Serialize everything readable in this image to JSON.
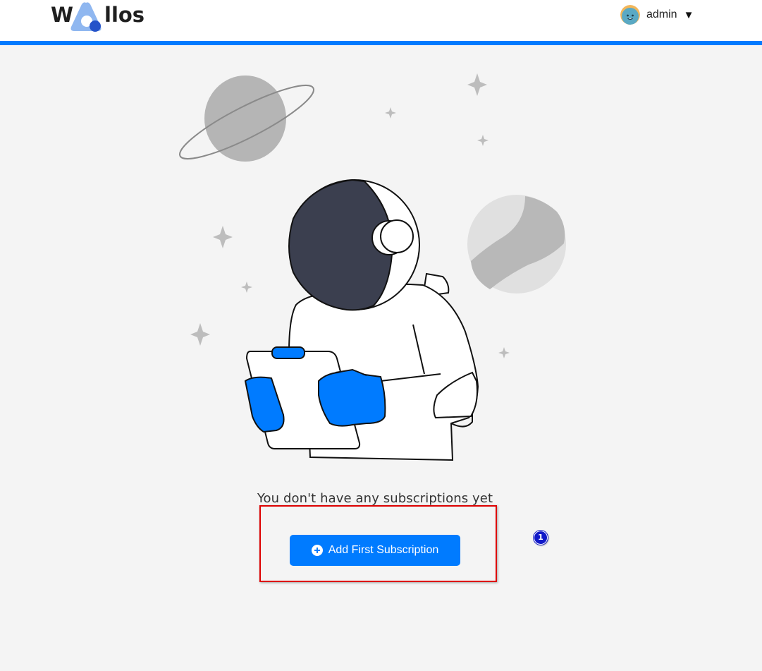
{
  "app": {
    "logo_left": "W",
    "logo_right": "llos"
  },
  "user_menu": {
    "username": "admin",
    "caret": "▼",
    "avatar_icon": "avatar-face-icon"
  },
  "empty_state": {
    "message": "You don't have any subscriptions yet",
    "add_button_label": "Add First Subscription",
    "add_button_icon": "plus-circle-icon"
  },
  "annotation": {
    "marker_number": "1"
  },
  "colors": {
    "accent": "#007bff",
    "background": "#f4f4f4",
    "highlight": "#dd0000",
    "marker": "#1018c8"
  }
}
